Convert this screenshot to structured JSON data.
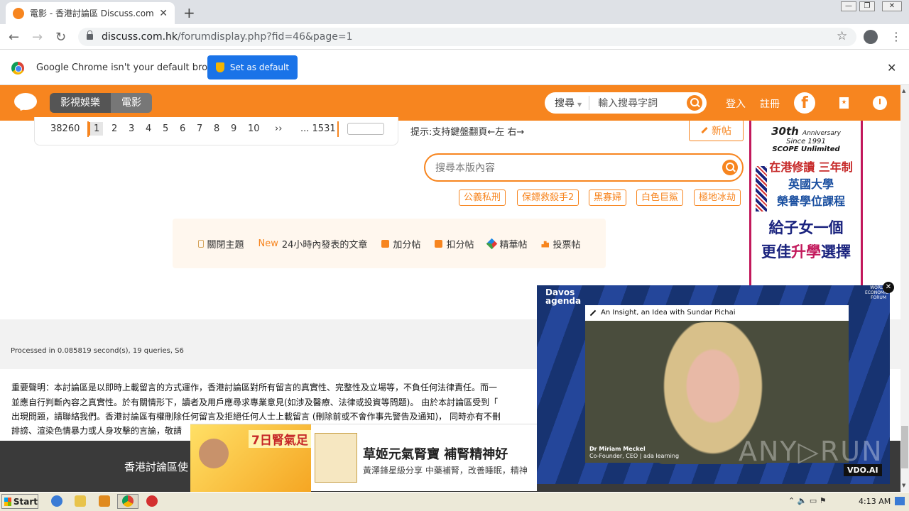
{
  "browser": {
    "tab_title": "電影 - 香港討論區 Discuss.com.hk -",
    "tab_close": "✕",
    "new_tab": "+",
    "url_host": "discuss.com.hk",
    "url_path": "/forumdisplay.php?fid=46&page=1",
    "back": "←",
    "forward": "→",
    "reload": "↻",
    "star": "☆",
    "menu": "⋮",
    "infobar_text": "Google Chrome isn't your default browser",
    "set_default_label": "Set as default",
    "infobar_close": "✕",
    "window_buttons": [
      "—",
      "❐",
      "✕"
    ]
  },
  "site": {
    "header_color": "#f7851f",
    "category_primary": "影視娛樂",
    "category_secondary": "電影",
    "search_select": "搜尋",
    "search_select_arrow": "▼",
    "search_placeholder": "輸入搜尋字詞",
    "login": "登入",
    "register": "註冊",
    "facebook": "f"
  },
  "pager": {
    "total": "38260",
    "pages": [
      "1",
      "2",
      "3",
      "4",
      "5",
      "6",
      "7",
      "8",
      "9",
      "10"
    ],
    "current": "1",
    "next": "››",
    "last": "... 1531"
  },
  "hint": "提示:支持鍵盤翻頁←左 右→",
  "new_post_label": "新帖",
  "forum_search_placeholder": "搜尋本版內容",
  "tags": [
    "公義私刑",
    "保鏢救殺手2",
    "黑寡婦",
    "白色巨鯊",
    "極地冰劫"
  ],
  "filters": {
    "closed": "關閉主題",
    "new_badge": "New",
    "new_24h": "24小時內發表的文章",
    "plus": "加分帖",
    "minus": "扣分帖",
    "digest": "精華帖",
    "poll": "投票帖"
  },
  "side_ad": {
    "line1": "30th",
    "line1b": "Anniversary",
    "line2": "Since 1991",
    "line3": "SCOPE Unlimited",
    "line4": "在港修讀 三年制",
    "line5": "英國大學",
    "line6": "榮譽學位課程",
    "line7": "給子女一個",
    "line8a": "更佳",
    "line8b": "升學",
    "line8c": "選擇"
  },
  "processed": "Processed in 0.085819 second(s), 19 queries, S6",
  "disclaimer": [
    "重要聲明：本討論區是以即時上載留言的方式運作，香港討論區對所有留言的真實性、完整性及立場等，不負任何法律責任。而一",
    "並應自行判斷內容之真實性。於有關情形下，讀者及用戶應尋求專業意見(如涉及醫療、法律或投資等問題)。 由於本討論區受到「",
    "出現問題，請聯絡我們。香港討論區有權刪除任何留言及拒絕任何人士上載留言 (刪除前或不會作事先警告及通知)， 同時亦有不刪",
    "誹謗、渲染色情暴力或人身攻擊的言論，敬請"
  ],
  "footer_dark_text": "香港討論區使",
  "banner_ad": {
    "badge": "7日腎氣足",
    "title": "草姬元氣腎寶 補腎精神好",
    "subtitle": "黃澤鋒星級分享 中藥補腎，改善睡眠，精神"
  },
  "video": {
    "brand_top": "Davos",
    "brand_bottom": "agenda",
    "wef": "WORLD ECONOMIC FORUM",
    "headline": "An Insight, an Idea with Sundar Pichai",
    "speaker_name": "Dr Miriam Meckel",
    "speaker_role": "Co-Founder, CEO | ada learning",
    "watermark": "ANY▷RUN",
    "vdo": "VDO.AI",
    "close": "✕"
  },
  "taskbar": {
    "start": "Start",
    "time": "4:13 AM"
  }
}
